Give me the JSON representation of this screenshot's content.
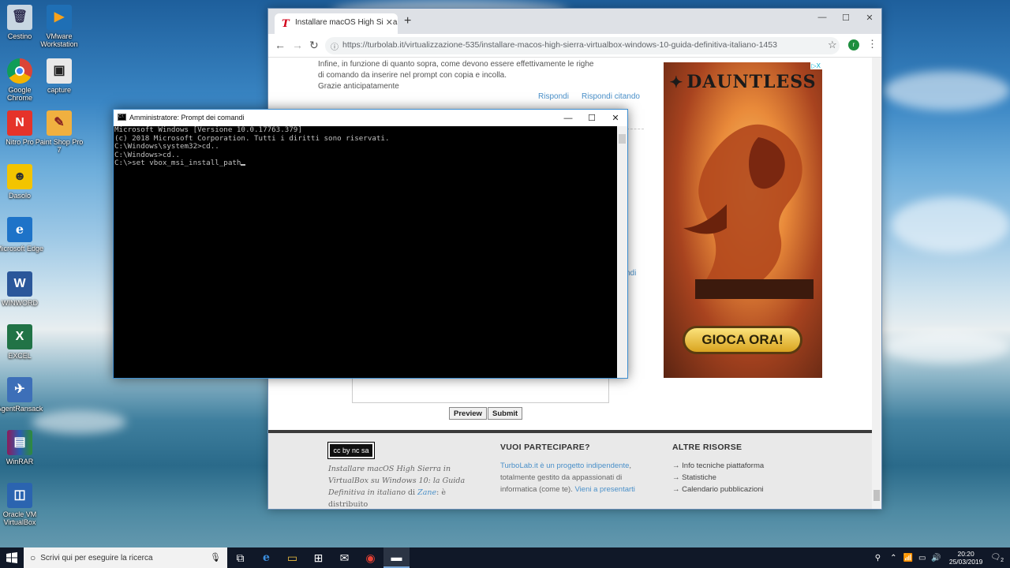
{
  "desktop": {
    "icons": [
      {
        "label": "Cestino",
        "glyph": "🗑"
      },
      {
        "label": "VMware Workstation",
        "glyph": "▶"
      },
      {
        "label": "Google Chrome",
        "glyph": "◉"
      },
      {
        "label": "capture",
        "glyph": "📷"
      },
      {
        "label": "Nitro Pro",
        "glyph": "N"
      },
      {
        "label": "Paint Shop Pro 7",
        "glyph": "🎨"
      },
      {
        "label": "Dasolo",
        "glyph": "☻"
      },
      {
        "label": "Microsoft Edge",
        "glyph": "e"
      },
      {
        "label": "WINWORD",
        "glyph": "W"
      },
      {
        "label": "EXCEL",
        "glyph": "X"
      },
      {
        "label": "AgentRansack",
        "glyph": "✈"
      },
      {
        "label": "WinRAR",
        "glyph": "▤"
      },
      {
        "label": "Oracle VM VirtualBox",
        "glyph": "◫"
      }
    ]
  },
  "browser": {
    "tab_title": "Installare macOS High Sierra in V",
    "tab_icon": "T",
    "url": "https://turbolab.it/virtualizzazione-535/installare-macos-high-sierra-virtualbox-windows-10-guida-definitiva-italiano-1453",
    "profile_initial": "r",
    "page": {
      "comment_lines": [
        "Infine, in funzione di quanto sopra, come devono essere effettivamente le righe",
        "di comando da inserire nel prompt con copia e incolla.",
        "Grazie anticipatamente"
      ],
      "reply": "Rispondi",
      "reply_quote": "Rispondi citando",
      "fragment": "ndi",
      "preview_button": "Preview",
      "submit_button": "Submit",
      "ad": {
        "brand": "DAUNTLESS",
        "cta": "GIOCA ORA!",
        "adchoices": "▷X"
      },
      "footer": {
        "license_badge": "cc by nc sa",
        "license_text_1": "Installare macOS High Sierra in",
        "license_text_2": "VirtualBox su Windows 10: la Guida",
        "license_text_3": "Definitiva in italiano",
        "license_text_di": " di ",
        "license_author": "Zane",
        "license_text_4": ": è distribuito",
        "col2_title": "VUOI PARTECIPARE?",
        "col2_link": "TurboLab.it è un progetto indipendente",
        "col2_line2": "totalmente gestito da appassionati di",
        "col2_line3": "informatica (come te).",
        "col2_link2": "Vieni a presentarti",
        "col3_title": "ALTRE RISORSE",
        "col3_items": [
          "Info tecniche piattaforma",
          "Statistiche",
          "Calendario pubblicazioni"
        ]
      }
    }
  },
  "cmd": {
    "title": "Amministratore: Prompt dei comandi",
    "lines": [
      "Microsoft Windows [Versione 10.0.17763.379]",
      "(c) 2018 Microsoft Corporation. Tutti i diritti sono riservati.",
      "",
      "C:\\Windows\\system32>cd..",
      "",
      "C:\\Windows>cd..",
      ""
    ],
    "current_input": "C:\\>set vbox_msi_install_path"
  },
  "taskbar": {
    "search_placeholder": "Scrivi qui per eseguire la ricerca",
    "time": "20:20",
    "date": "25/03/2019",
    "notifications": "2"
  },
  "colors": {
    "accent": "#4a90c9",
    "taskbar": "#101828",
    "cmd_bg": "#000000"
  }
}
